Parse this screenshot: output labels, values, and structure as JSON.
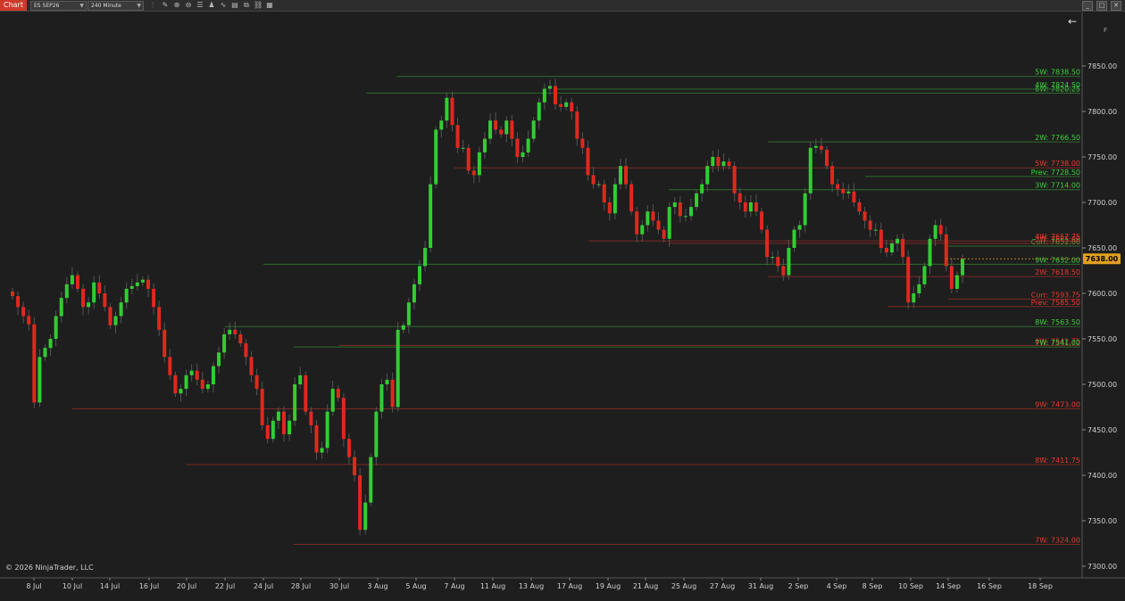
{
  "toolbar": {
    "tab_label": "Chart",
    "instrument": "ES SEP26",
    "interval": "240 Minute",
    "icons": [
      "bar-type-icon",
      "drawing-icon",
      "zoom-in-icon",
      "zoom-out-icon",
      "properties-icon",
      "strategy-icon",
      "indicator-icon",
      "data-box-icon",
      "copy-icon",
      "link-icon",
      "template-icon"
    ],
    "window_buttons": [
      "_",
      "□",
      "✕"
    ]
  },
  "copyright": "© 2026 NinjaTrader, LLC",
  "axis_f_label": "F",
  "colors": {
    "background": "#1e1e1e",
    "up": "#32cd32",
    "down": "#e0281e",
    "green_text": "#3cd03c",
    "red_text": "#e83a2a",
    "current_price_badge": "#e0a020"
  },
  "chart_data": {
    "type": "candlestick",
    "instrument": "ES SEP26",
    "interval": "240 Minute",
    "ylim": [
      7290,
      7880
    ],
    "y_ticks": [
      7300,
      7350,
      7400,
      7450,
      7500,
      7550,
      7600,
      7650,
      7700,
      7750,
      7800,
      7850
    ],
    "y_tick_labels": [
      "7300.00",
      "7350.00",
      "7400.00",
      "7450.00",
      "7500.00",
      "7550.00",
      "7600.00",
      "7650.00",
      "7700.00",
      "7750.00",
      "7800.00",
      "7850.00"
    ],
    "x_labels": [
      "8 Jul",
      "10 Jul",
      "14 Jul",
      "16 Jul",
      "20 Jul",
      "22 Jul",
      "24 Jul",
      "28 Jul",
      "30 Jul",
      "3 Aug",
      "5 Aug",
      "7 Aug",
      "11 Aug",
      "13 Aug",
      "17 Aug",
      "19 Aug",
      "21 Aug",
      "25 Aug",
      "27 Aug",
      "31 Aug",
      "2 Sep",
      "4 Sep",
      "8 Sep",
      "10 Sep",
      "14 Sep",
      "16 Sep",
      "18 Sep"
    ],
    "current_price": "7638.00",
    "grid": false,
    "levels": [
      {
        "label": "5W: 7838.50",
        "value": 7838.5,
        "color": "green",
        "from": "4 Aug"
      },
      {
        "label": "6W: 7820.25",
        "value": 7820.25,
        "color": "green",
        "from": "1 Aug"
      },
      {
        "label": "4W: 7824.50",
        "value": 7824.5,
        "color": "green",
        "from": "14 Aug"
      },
      {
        "label": "2W: 7766.50",
        "value": 7766.5,
        "color": "green",
        "from": "1 Sep"
      },
      {
        "label": "5W: 7738.00",
        "value": 7738.0,
        "color": "red",
        "from": "7 Aug"
      },
      {
        "label": "Prev: 7728.50",
        "value": 7728.5,
        "color": "green",
        "from": "5 Sep"
      },
      {
        "label": "3W: 7714.00",
        "value": 7714.0,
        "color": "green",
        "from": "24 Aug"
      },
      {
        "label": "Curr: 7652.00",
        "value": 7652.0,
        "color": "green",
        "from": "14 Sep"
      },
      {
        "label": "4W: 7657.75",
        "value": 7657.75,
        "color": "red",
        "from": "18 Aug"
      },
      {
        "label": "3W: 7655.00",
        "value": 7655.0,
        "color": "red",
        "from": "24 Aug"
      },
      {
        "label": "9W: 7632.00",
        "value": 7632.0,
        "color": "green",
        "from": "24 Jul"
      },
      {
        "label": "2W: 7618.50",
        "value": 7618.5,
        "color": "red",
        "from": "1 Sep"
      },
      {
        "label": "Curr: 7593.75",
        "value": 7593.75,
        "color": "red",
        "from": "14 Sep"
      },
      {
        "label": "Prev: 7585.50",
        "value": 7585.5,
        "color": "red",
        "from": "8 Sep"
      },
      {
        "label": "8W: 7563.50",
        "value": 7563.5,
        "color": "green",
        "from": "22 Jul"
      },
      {
        "label": "6W: 7542.75",
        "value": 7542.75,
        "color": "red",
        "from": "30 Jul"
      },
      {
        "label": "7W: 7541.00",
        "value": 7541.0,
        "color": "green",
        "from": "27 Jul"
      },
      {
        "label": "9W: 7473.00",
        "value": 7473.0,
        "color": "red",
        "from": "10 Jul"
      },
      {
        "label": "8W: 7411.75",
        "value": 7411.75,
        "color": "red",
        "from": "20 Jul"
      },
      {
        "label": "7W: 7324.00",
        "value": 7324.0,
        "color": "red",
        "from": "27 Jul"
      }
    ],
    "ohlc_source_closes": [
      7597,
      7585,
      7575,
      7566,
      7480,
      7530,
      7540,
      7550,
      7575,
      7595,
      7610,
      7620,
      7605,
      7585,
      7590,
      7612,
      7600,
      7585,
      7565,
      7575,
      7590,
      7605,
      7608,
      7612,
      7615,
      7605,
      7585,
      7560,
      7530,
      7510,
      7490,
      7495,
      7510,
      7515,
      7505,
      7495,
      7500,
      7520,
      7535,
      7555,
      7560,
      7555,
      7545,
      7530,
      7510,
      7495,
      7455,
      7440,
      7460,
      7470,
      7445,
      7460,
      7500,
      7510,
      7470,
      7455,
      7425,
      7430,
      7470,
      7495,
      7485,
      7440,
      7420,
      7400,
      7340,
      7370,
      7420,
      7470,
      7500,
      7505,
      7475,
      7560,
      7565,
      7590,
      7610,
      7630,
      7650,
      7720,
      7780,
      7790,
      7815,
      7785,
      7760,
      7760,
      7735,
      7730,
      7755,
      7770,
      7790,
      7780,
      7775,
      7790,
      7770,
      7750,
      7755,
      7770,
      7790,
      7810,
      7825,
      7828,
      7808,
      7805,
      7810,
      7800,
      7770,
      7760,
      7730,
      7720,
      7720,
      7700,
      7688,
      7720,
      7740,
      7720,
      7690,
      7665,
      7675,
      7690,
      7680,
      7670,
      7660,
      7695,
      7700,
      7685,
      7685,
      7695,
      7710,
      7720,
      7740,
      7750,
      7740,
      7745,
      7740,
      7710,
      7700,
      7690,
      7700,
      7690,
      7670,
      7640,
      7640,
      7630,
      7620,
      7650,
      7670,
      7675,
      7710,
      7760,
      7762,
      7758,
      7740,
      7720,
      7715,
      7710,
      7712,
      7700,
      7690,
      7680,
      7670,
      7670,
      7650,
      7645,
      7655,
      7660,
      7640,
      7590,
      7600,
      7610,
      7630,
      7660,
      7675,
      7665,
      7630,
      7605,
      7620,
      7638
    ]
  }
}
